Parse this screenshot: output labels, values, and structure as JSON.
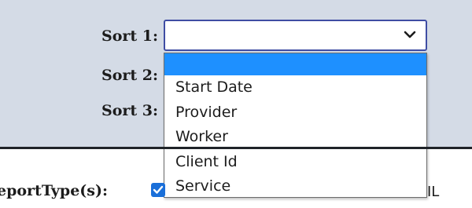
{
  "sort_fields": [
    {
      "label": "Sort 1:"
    },
    {
      "label": "Sort 2:"
    },
    {
      "label": "Sort 3:"
    }
  ],
  "sort1_select": {
    "selected_value": "",
    "icon": "chevron-down-icon",
    "border_color": "#3f4da3"
  },
  "dropdown": {
    "options": [
      "",
      "Start Date",
      "Provider",
      "Worker",
      "Client Id",
      "Service"
    ],
    "highlighted_index": 0,
    "highlight_color": "#1e90ff"
  },
  "report_type": {
    "label": "eportType(s):",
    "checkbox_checked": true,
    "checkbox_color": "#1a6fd9",
    "trailing_text": "IL"
  },
  "colors": {
    "panel_background": "#d4dbe6",
    "divider": "#1f2328"
  }
}
